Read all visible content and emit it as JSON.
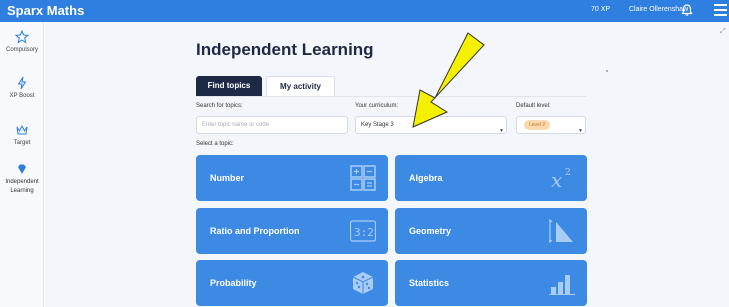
{
  "app": {
    "brand": "Sparx Maths",
    "xp": "70 XP",
    "user_name": "Claire Ollerenshaw"
  },
  "sidebar": {
    "items": [
      {
        "label": "Compulsory",
        "icon": "star-icon"
      },
      {
        "label": "XP Boost",
        "icon": "bolt-icon"
      },
      {
        "label": "Target",
        "icon": "crown-icon"
      },
      {
        "label": "Independent Learning",
        "icon": "diamond-icon",
        "active": true
      }
    ]
  },
  "page": {
    "title": "Independent Learning"
  },
  "tabs": [
    {
      "label": "Find topics",
      "active": true
    },
    {
      "label": "My activity",
      "active": false
    }
  ],
  "search": {
    "label": "Search for topics:",
    "placeholder": "Enter topic name or code"
  },
  "curriculum": {
    "label": "Your curriculum:",
    "value": "Key Stage 3"
  },
  "level": {
    "label": "Default level:",
    "value": "Level 2"
  },
  "select_label": "Select a topic:",
  "topics": [
    {
      "label": "Number",
      "icon": "number-grid-icon"
    },
    {
      "label": "Algebra",
      "icon": "x-squared-icon"
    },
    {
      "label": "Ratio and Proportion",
      "icon": "ratio-icon"
    },
    {
      "label": "Geometry",
      "icon": "triangle-icon"
    },
    {
      "label": "Probability",
      "icon": "dice-icon"
    },
    {
      "label": "Statistics",
      "icon": "bar-chart-icon"
    }
  ],
  "colors": {
    "topbar": "#2f7fe0",
    "card": "#3d8ae4",
    "tab_active": "#1e2a45",
    "annotation_arrow": "#f5f000"
  }
}
